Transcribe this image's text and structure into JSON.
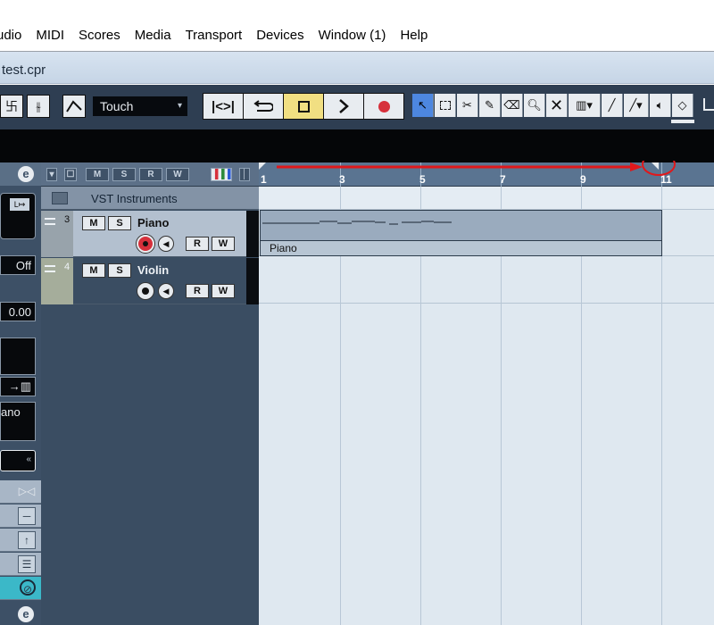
{
  "menu": {
    "items": [
      "udio",
      "MIDI",
      "Scores",
      "Media",
      "Transport",
      "Devices",
      "Window (1)",
      "Help"
    ]
  },
  "window": {
    "title": "test.cpr"
  },
  "toolbar": {
    "automation_mode": "Touch",
    "transport": {
      "rewind_icon": "go-to-marker-icon",
      "cycle_icon": "cycle-icon",
      "stop_icon": "stop-icon",
      "play_icon": "play-icon",
      "record_icon": "record-icon"
    },
    "tools": [
      "object-select-icon",
      "range-select-icon",
      "split-icon",
      "glue-icon",
      "erase-icon",
      "zoom-icon",
      "mute-icon",
      "comp-icon",
      "draw-icon",
      "line-icon",
      "play-tool-icon",
      "color-icon"
    ]
  },
  "inspector": {
    "off_label": "Off",
    "value_label": "0.00",
    "instrument_label": "ano"
  },
  "tracklist": {
    "folder_name": "VST Instruments",
    "tracks": [
      {
        "number": "3",
        "name": "Piano",
        "mute": "M",
        "solo": "S",
        "read": "R",
        "write": "W"
      },
      {
        "number": "4",
        "name": "Violin",
        "mute": "M",
        "solo": "S",
        "read": "R",
        "write": "W"
      }
    ]
  },
  "ruler": {
    "bars": [
      "1",
      "3",
      "5",
      "7",
      "9",
      "11"
    ]
  },
  "events": {
    "part_name": "Piano"
  },
  "colors": {
    "toolbar_bg": "#2e3e52",
    "transport_active": "#f1df82",
    "record_red": "#d6303b",
    "annotation_red": "#e0181b"
  }
}
